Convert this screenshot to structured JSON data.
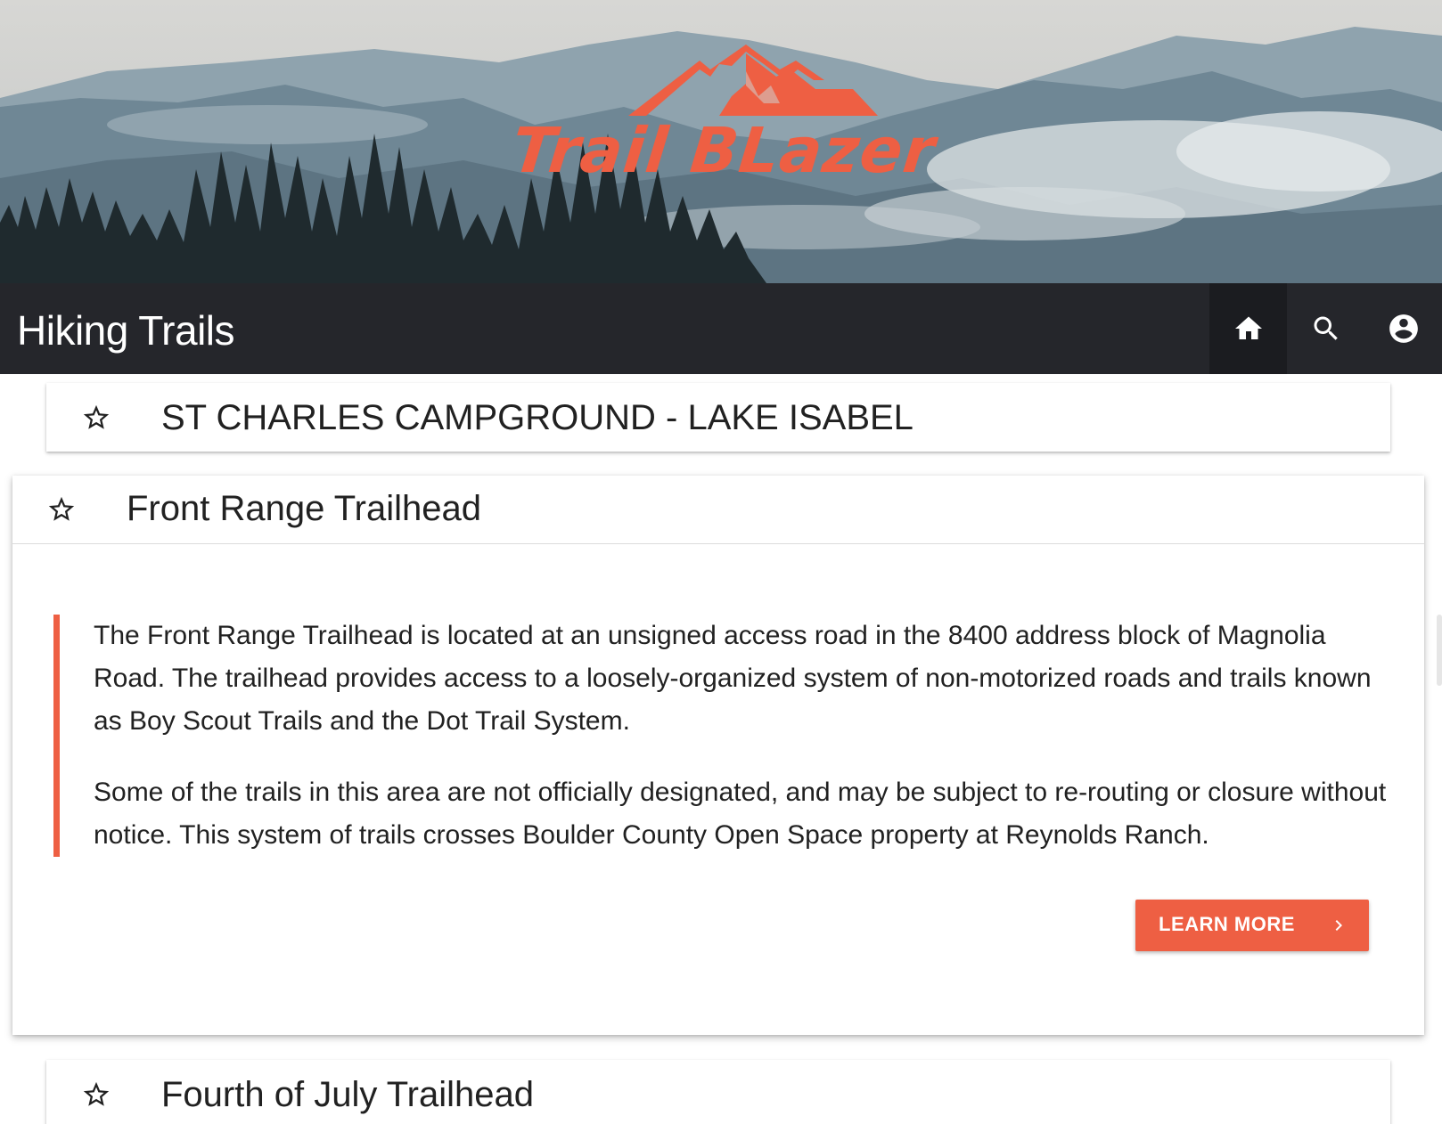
{
  "brand": {
    "logo_text": "Trail BLazer",
    "accent_color": "#ee5f43"
  },
  "appbar": {
    "title": "Hiking Trails",
    "background": "#25262b",
    "actions": [
      {
        "icon": "home-icon",
        "active": true
      },
      {
        "icon": "search-icon",
        "active": false
      },
      {
        "icon": "account-circle-icon",
        "active": false
      }
    ]
  },
  "trails": [
    {
      "title": "ST CHARLES CAMPGROUND - LAKE ISABEL",
      "favorite_icon": "star-outline-icon",
      "expanded": false
    },
    {
      "title": "Front Range Trailhead",
      "favorite_icon": "star-outline-icon",
      "expanded": true,
      "paragraphs": [
        "The Front Range Trailhead is located at an unsigned access road in the 8400 address block of Magnolia Road. The trailhead provides access to a loosely-organized system of non-motorized roads and trails known as Boy Scout Trails and the Dot Trail System.",
        "Some of the trails in this area are not officially designated, and may be subject to re-routing or closure without notice. This system of trails crosses Boulder County Open Space property at Reynolds Ranch."
      ],
      "button_label": "LEARN MORE",
      "button_icon": "chevron-right-icon"
    },
    {
      "title": "Fourth of July Trailhead",
      "favorite_icon": "star-outline-icon",
      "expanded": false
    }
  ]
}
